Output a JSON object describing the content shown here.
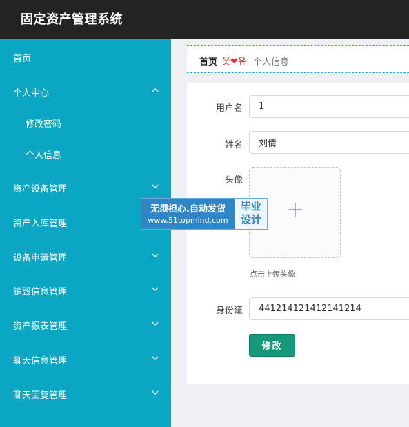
{
  "app": {
    "title": "固定资产管理系统"
  },
  "sidebar": {
    "items": [
      {
        "label": "首页",
        "expandable": false
      },
      {
        "label": "个人中心",
        "expandable": true,
        "expanded": true
      },
      {
        "label": "修改密码",
        "sub": true
      },
      {
        "label": "个人信息",
        "sub": true
      },
      {
        "label": "资产设备管理",
        "expandable": true
      },
      {
        "label": "资产入库管理",
        "expandable": true
      },
      {
        "label": "设备申请管理",
        "expandable": true
      },
      {
        "label": "销毁信息管理",
        "expandable": true
      },
      {
        "label": "资产报表管理",
        "expandable": true
      },
      {
        "label": "聊天信息管理",
        "expandable": true
      },
      {
        "label": "聊天回复管理",
        "expandable": true
      }
    ]
  },
  "breadcrumb": {
    "home": "首页",
    "separator": "웃❤유",
    "current": "个人信息"
  },
  "form": {
    "username_label": "用户名",
    "username_value": "1",
    "name_label": "姓名",
    "name_value": "刘倩",
    "avatar_label": "头像",
    "upload_hint": "点击上传头像",
    "id_card_label": "身份证",
    "id_card_value": "441214121412141214",
    "submit_label": "修改"
  },
  "watermark": {
    "line1": "无须担心.自动发货",
    "line2": "www.51topmind.com",
    "badge_line1": "毕业",
    "badge_line2": "设计"
  },
  "colors": {
    "topbar": "#232323",
    "sidebar": "#0aa6c4",
    "submit": "#16987a",
    "breadcrumb_separator": "#e0302a"
  }
}
